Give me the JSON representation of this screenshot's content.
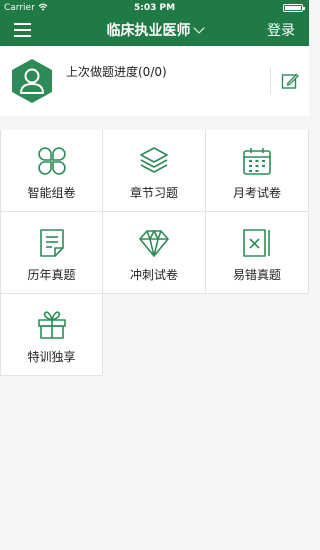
{
  "status_bar": {
    "carrier": "Carrier",
    "time": "5:03 PM"
  },
  "nav": {
    "title": "临床执业医师",
    "login": "登录"
  },
  "profile": {
    "progress_text": "上次做题进度(0/0)"
  },
  "colors": {
    "brand_green": "#1f7a45",
    "icon_green": "#2e8b57"
  },
  "menu_items": [
    {
      "label": "智能组卷",
      "icon": "clover-icon"
    },
    {
      "label": "章节习题",
      "icon": "layers-icon"
    },
    {
      "label": "月考试卷",
      "icon": "calendar-icon"
    },
    {
      "label": "历年真题",
      "icon": "document-icon"
    },
    {
      "label": "冲刺试卷",
      "icon": "diamond-icon"
    },
    {
      "label": "易错真题",
      "icon": "wrong-book-icon"
    },
    {
      "label": "特训独享",
      "icon": "gift-icon"
    }
  ]
}
